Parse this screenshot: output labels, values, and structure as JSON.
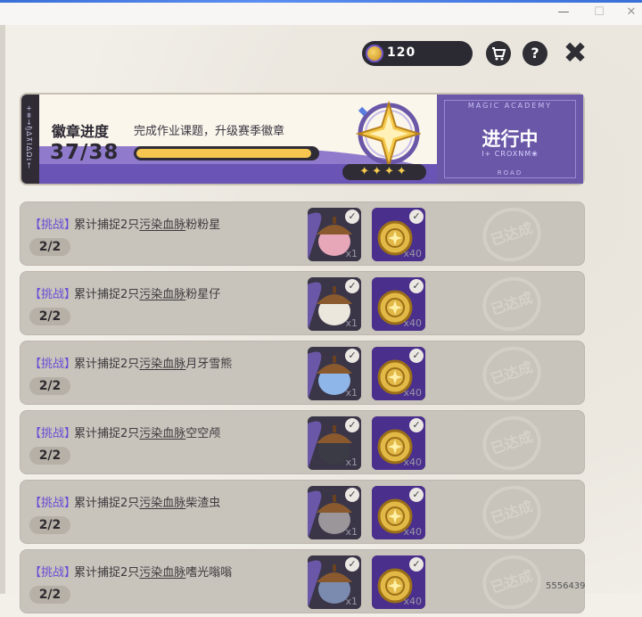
{
  "hud": {
    "coins": "120"
  },
  "banner": {
    "title": "徽章进度",
    "subtitle": "完成作业课题，升级赛季徽章",
    "progress_text": "37/38",
    "progress_value": 0.97,
    "stars": "✦✦✦✦",
    "side_text": "+≡→ɧ∆⊼I∆Ωɪ†",
    "status": "进行中",
    "status_top": "MAGIC ACADEMY",
    "status_mid": "I+ CROXNM❀",
    "status_bot": "ROAD"
  },
  "tasks": [
    {
      "tag": "【挑战】",
      "prefix": "累计捕捉2只",
      "keyword": "污染血脉",
      "target": "粉粉星",
      "progress": "2/2",
      "rewards": [
        {
          "qty": "x1",
          "icon": "acorn-pink"
        },
        {
          "qty": "x40",
          "icon": "coin-purple"
        }
      ],
      "stamp": "已达成"
    },
    {
      "tag": "【挑战】",
      "prefix": "累计捕捉2只",
      "keyword": "污染血脉",
      "target": "粉星仔",
      "progress": "2/2",
      "rewards": [
        {
          "qty": "x1",
          "icon": "acorn-white"
        },
        {
          "qty": "x40",
          "icon": "coin-purple"
        }
      ],
      "stamp": "已达成"
    },
    {
      "tag": "【挑战】",
      "prefix": "累计捕捉2只",
      "keyword": "污染血脉",
      "target": "月牙雪熊",
      "progress": "2/2",
      "rewards": [
        {
          "qty": "x1",
          "icon": "acorn-blue"
        },
        {
          "qty": "x40",
          "icon": "coin-purple"
        }
      ],
      "stamp": "已达成"
    },
    {
      "tag": "【挑战】",
      "prefix": "累计捕捉2只",
      "keyword": "污染血脉",
      "target": "空空颅",
      "progress": "2/2",
      "rewards": [
        {
          "qty": "x1",
          "icon": "acorn-dark"
        },
        {
          "qty": "x40",
          "icon": "coin-purple"
        }
      ],
      "stamp": "已达成"
    },
    {
      "tag": "【挑战】",
      "prefix": "累计捕捉2只",
      "keyword": "污染血脉",
      "target": "柴渣虫",
      "progress": "2/2",
      "rewards": [
        {
          "qty": "x1",
          "icon": "acorn-gray"
        },
        {
          "qty": "x40",
          "icon": "coin-purple"
        }
      ],
      "stamp": "已达成"
    },
    {
      "tag": "【挑战】",
      "prefix": "累计捕捉2只",
      "keyword": "污染血脉",
      "target": "嗜光嗡嗡",
      "progress": "2/2",
      "rewards": [
        {
          "qty": "x1",
          "icon": "acorn-striped"
        },
        {
          "qty": "x40",
          "icon": "coin-purple"
        }
      ],
      "stamp": "已达成"
    }
  ],
  "watermark": "5556439",
  "colors": {
    "accent": "#6a57a8",
    "tag": "#6a4cd6",
    "progress": "#f6c650",
    "row_bg": "#c8c3bb"
  }
}
